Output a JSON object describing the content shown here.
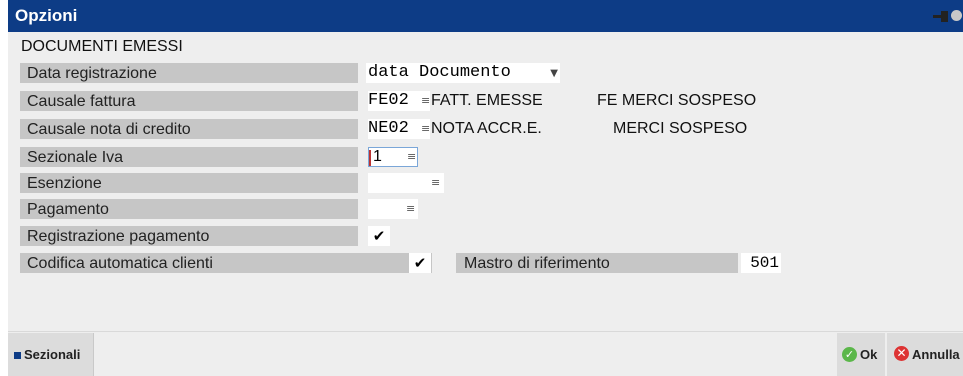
{
  "window": {
    "title": "Opzioni"
  },
  "section_title": "DOCUMENTI EMESSI",
  "fields": {
    "data_registrazione": {
      "label": "Data registrazione",
      "value": "data Documento"
    },
    "causale_fattura": {
      "label": "Causale fattura",
      "code": "FE02",
      "desc1": "FATT. EMESSE",
      "desc2": "FE MERCI SOSPESO"
    },
    "causale_nota_credito": {
      "label": "Causale nota di credito",
      "code": "NE02",
      "desc1": "NOTA ACCR.E.",
      "desc2": "MERCI SOSPESO"
    },
    "sezionale_iva": {
      "label": "Sezionale Iva",
      "value": "1"
    },
    "esenzione": {
      "label": "Esenzione",
      "value": ""
    },
    "pagamento": {
      "label": "Pagamento",
      "value": ""
    },
    "registrazione_pagamento": {
      "label": "Registrazione pagamento",
      "checked": true
    },
    "codifica_automatica_clienti": {
      "label": "Codifica automatica clienti",
      "checked": true
    },
    "mastro_riferimento": {
      "label": "Mastro di riferimento",
      "value": "501"
    }
  },
  "buttons": {
    "sezionali": "Sezionali",
    "ok": "Ok",
    "annulla": "Annulla"
  },
  "colors": {
    "titlebar": "#0d3c86",
    "panel": "#eeeeee",
    "label_bg": "#c6c6c6",
    "ok_green": "#5bb74a",
    "cancel_red": "#dd3333"
  }
}
